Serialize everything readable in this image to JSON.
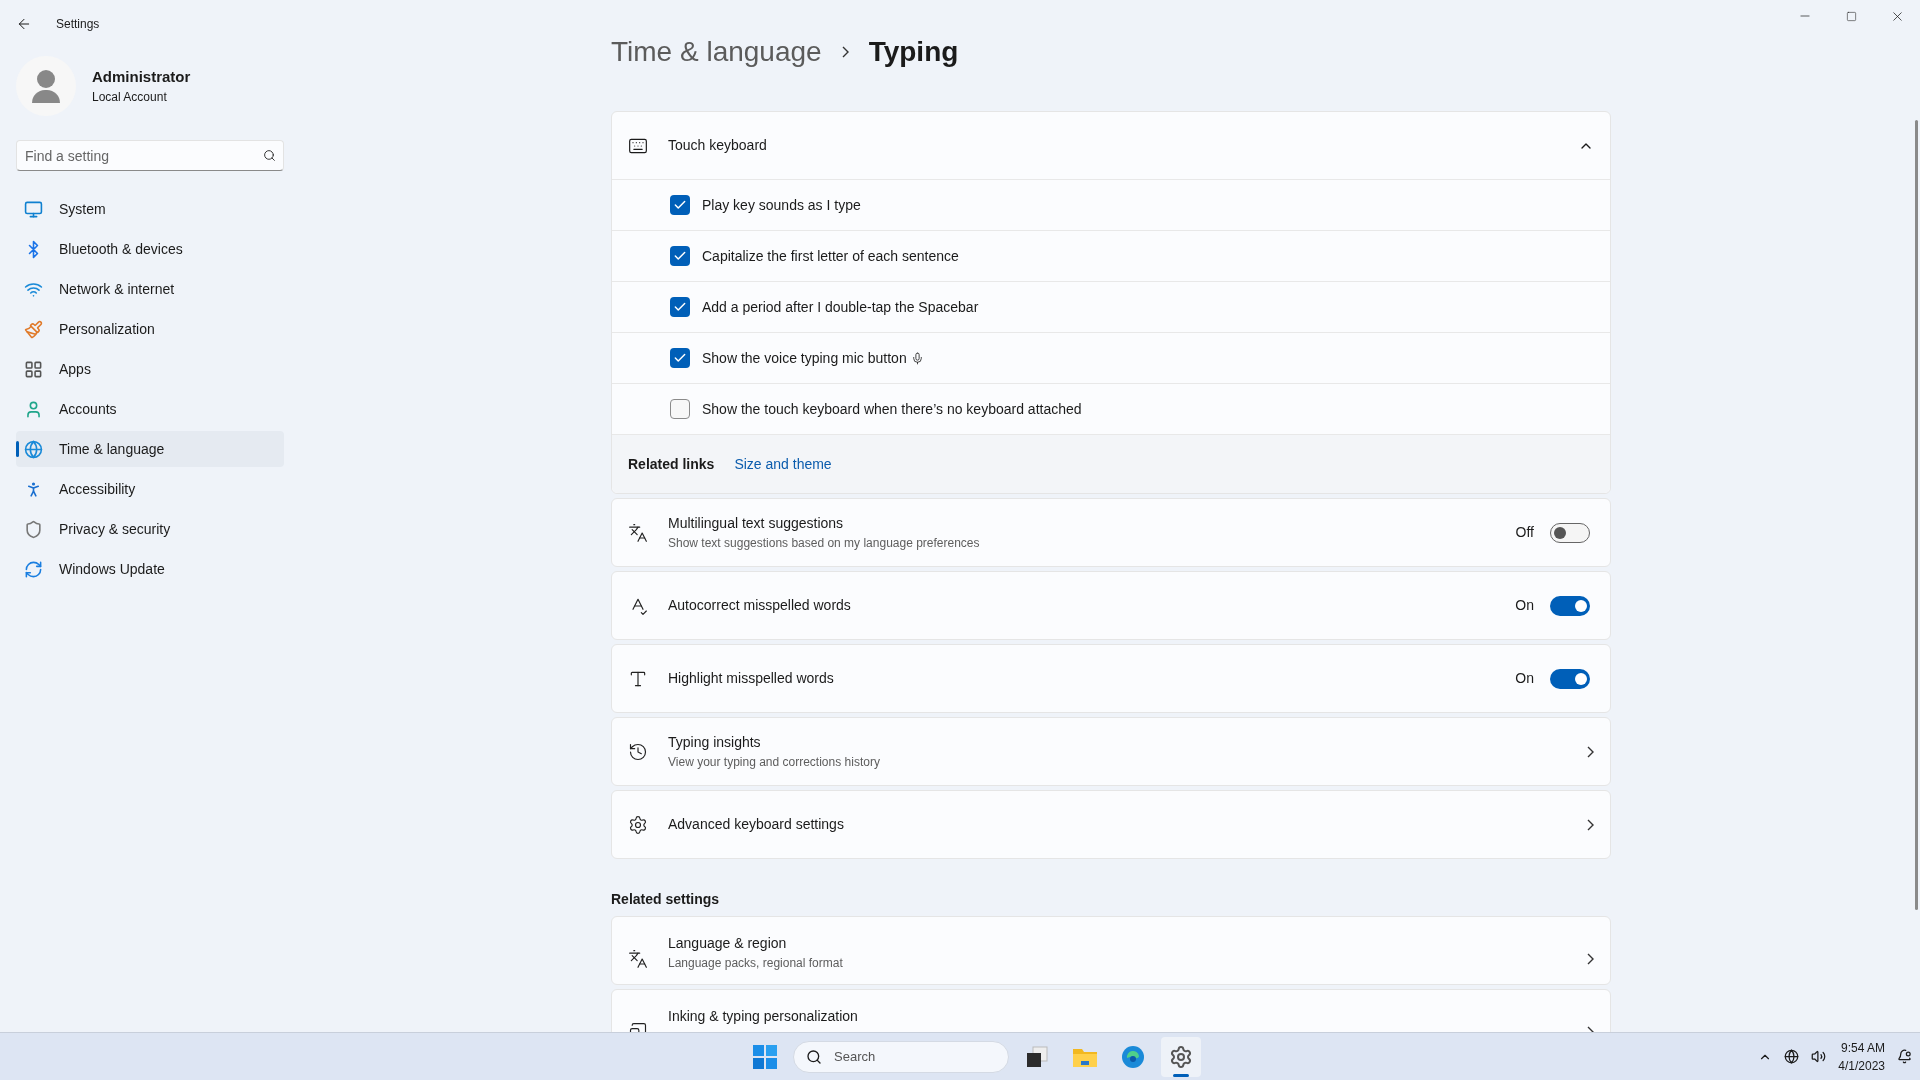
{
  "window": {
    "title": "Settings"
  },
  "user": {
    "name": "Administrator",
    "account": "Local Account"
  },
  "search": {
    "placeholder": "Find a setting"
  },
  "nav": [
    {
      "kind": "system",
      "label": "System",
      "selected": false
    },
    {
      "kind": "bluetooth",
      "label": "Bluetooth & devices",
      "selected": false
    },
    {
      "kind": "network",
      "label": "Network & internet",
      "selected": false
    },
    {
      "kind": "personalization",
      "label": "Personalization",
      "selected": false
    },
    {
      "kind": "apps",
      "label": "Apps",
      "selected": false
    },
    {
      "kind": "accounts",
      "label": "Accounts",
      "selected": false
    },
    {
      "kind": "time",
      "label": "Time & language",
      "selected": true
    },
    {
      "kind": "accessibility",
      "label": "Accessibility",
      "selected": false
    },
    {
      "kind": "privacy",
      "label": "Privacy & security",
      "selected": false
    },
    {
      "kind": "update",
      "label": "Windows Update",
      "selected": false
    }
  ],
  "breadcrumb": [
    "Time & language",
    "Typing"
  ],
  "touch_keyboard": {
    "title": "Touch keyboard",
    "expanded": true,
    "options": [
      {
        "kind": "plain",
        "label": "Play key sounds as I type",
        "checked": true
      },
      {
        "kind": "plain",
        "label": "Capitalize the first letter of each sentence",
        "checked": true
      },
      {
        "kind": "plain",
        "label": "Add a period after I double-tap the Spacebar",
        "checked": true
      },
      {
        "kind": "mic",
        "label": "Show the voice typing mic button",
        "checked": true
      },
      {
        "kind": "plain",
        "label": "Show the touch keyboard when there’s no keyboard attached",
        "checked": false
      }
    ],
    "related_links": {
      "label": "Related links",
      "links": [
        "Size and theme"
      ]
    }
  },
  "settings": [
    {
      "kind": "toggle",
      "title": "Multilingual text suggestions",
      "subtitle": "Show text suggestions based on my language preferences",
      "on": false,
      "state_label": "Off"
    },
    {
      "kind": "toggle",
      "title": "Autocorrect misspelled words",
      "on": true,
      "state_label": "On"
    },
    {
      "kind": "toggle",
      "title": "Highlight misspelled words",
      "on": true,
      "state_label": "On"
    },
    {
      "kind": "link",
      "title": "Typing insights",
      "subtitle": "View your typing and corrections history"
    },
    {
      "kind": "link",
      "title": "Advanced keyboard settings"
    }
  ],
  "related_settings": {
    "heading": "Related settings",
    "items": [
      {
        "title": "Language & region",
        "subtitle": "Language packs, regional format"
      },
      {
        "title": "Inking & typing personalization"
      }
    ]
  },
  "taskbar": {
    "search_placeholder": "Search",
    "apps": [
      {
        "kind": "taskview",
        "selected": false
      },
      {
        "kind": "explorer",
        "selected": false
      },
      {
        "kind": "browser",
        "selected": false
      },
      {
        "kind": "settings",
        "selected": true
      }
    ],
    "time": "9:54 AM",
    "date": "4/1/2023"
  }
}
